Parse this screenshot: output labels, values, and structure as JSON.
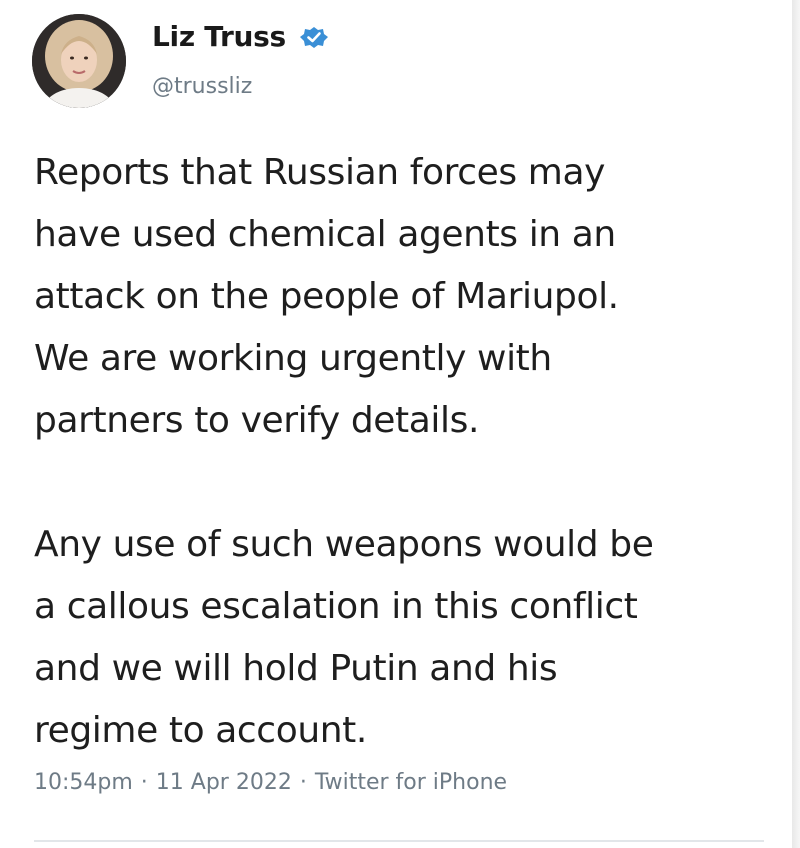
{
  "author": {
    "display_name": "Liz Truss",
    "handle": "@trussliz",
    "verified": true
  },
  "tweet": {
    "paragraphs": [
      "Reports that Russian forces may\nhave used chemical agents in an\nattack on the people of Mariupol.\nWe are working urgently with\npartners to verify details.",
      "Any use of such weapons would be\na callous escalation in this conflict\nand we will hold Putin and his\nregime to account."
    ],
    "time": "10:54pm",
    "date": "11 Apr 2022",
    "source": "Twitter for iPhone",
    "separator": "·"
  },
  "colors": {
    "text": "#1e1e1e",
    "secondary": "#6e7b86",
    "verified": "#1d9bf0"
  },
  "icons": {
    "verified": "verified-badge-icon",
    "avatar": "profile-photo"
  }
}
